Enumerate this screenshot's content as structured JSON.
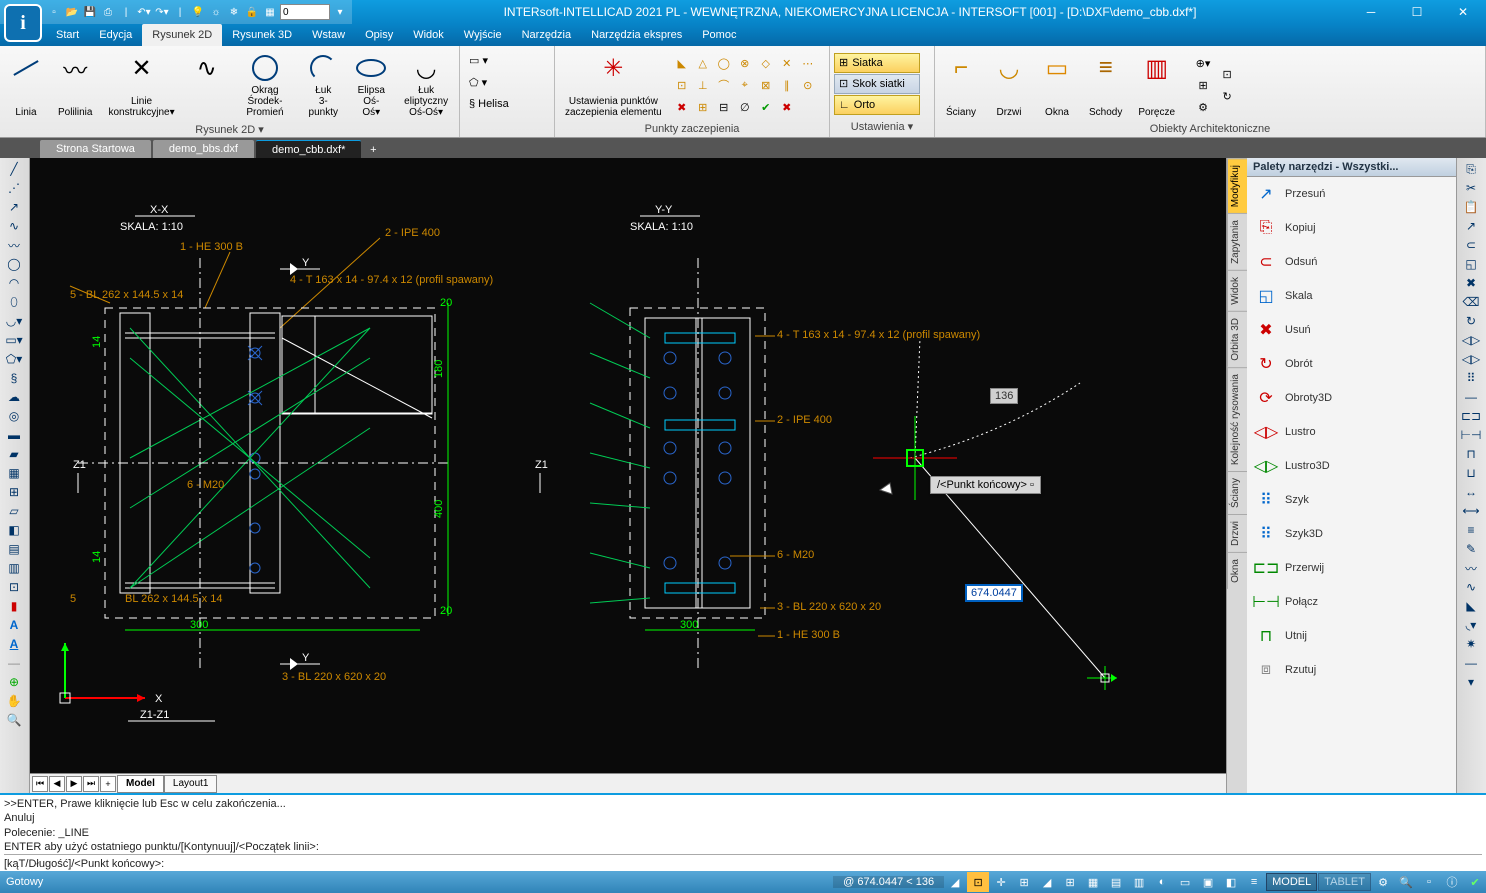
{
  "title": "INTERsoft-INTELLICAD 2021 PL - WEWNĘTRZNA, NIEKOMERCYJNA LICENCJA - INTERSOFT [001] - [D:\\DXF\\demo_cbb.dxf*]",
  "qat_value": "0",
  "menu": [
    "Start",
    "Edycja",
    "Rysunek 2D",
    "Rysunek 3D",
    "Wstaw",
    "Opisy",
    "Widok",
    "Wyjście",
    "Narzędzia",
    "Narzędzia ekspres",
    "Pomoc"
  ],
  "menu_active": 2,
  "ribbon": {
    "draw": {
      "label": "Rysunek 2D ▾",
      "buttons": {
        "line": "Linia",
        "polyline": "Polilinia",
        "constr_lines": "Linie\nkonstrukcyjne▾",
        "circle": "Okrąg\nŚrodek-Promień",
        "arc": "Łuk\n3-punkty",
        "ellipse": "Elipsa\nOś-Oś▾",
        "earc": "Łuk eliptyczny\nOś-Oś▾"
      },
      "helix": "Helisa"
    },
    "snap": {
      "label": "Punkty zaczepienia",
      "header": "Ustawienia punktów\nzaczepienia elementu"
    },
    "settings": {
      "label": "Ustawienia ▾",
      "grid": "Siatka",
      "grid_step": "Skok siatki",
      "ortho": "Orto"
    },
    "arch": {
      "label": "Obiekty Architektoniczne",
      "walls": "Ściany",
      "doors": "Drzwi",
      "windows": "Okna",
      "stairs": "Schody",
      "rails": "Poręcze"
    }
  },
  "doc_tabs": [
    "Strona Startowa",
    "demo_bbs.dxf",
    "demo_cbb.dxf*"
  ],
  "doc_tab_active": 2,
  "palette": {
    "title": "Palety narzędzi - Wszystki...",
    "tabs": [
      "Modyfikuj",
      "Zapytania",
      "Widok",
      "Orbita 3D",
      "Kolejność rysowania",
      "Ściany",
      "Drzwi",
      "Okna"
    ],
    "tab_active": 0,
    "items": [
      "Przesuń",
      "Kopiuj",
      "Odsuń",
      "Skala",
      "Usuń",
      "Obrót",
      "Obroty3D",
      "Lustro",
      "Lustro3D",
      "Szyk",
      "Szyk3D",
      "Przerwij",
      "Połącz",
      "Utnij",
      "Rzutuj"
    ]
  },
  "layout_tabs": [
    "Model",
    "Layout1"
  ],
  "layout_active": 0,
  "command_lines": [
    ">>ENTER, Prawe kliknięcie lub Esc w celu zakończenia...",
    "Anuluj",
    "Polecenie: _LINE",
    "ENTER aby użyć ostatniego punktu/[Kontynuuj]/<Początek linii>:"
  ],
  "command_prompt": "[kąT/Długość]/<Punkt końcowy>:",
  "status": {
    "left": "Gotowy",
    "coords": "@ 674.0447 < 136",
    "model": "MODEL",
    "tablet": "TABLET"
  },
  "canvas": {
    "tooltip": "/<Punkt końcowy>",
    "angle": "136",
    "coord": "674.0447",
    "labels": {
      "xx_title": "X-X",
      "xx_scale": "SKALA:  1:10",
      "yy_title": "Y-Y",
      "yy_scale": "SKALA:  1:10",
      "l1": "1 - HE 300 B",
      "l2": "2 - IPE 400",
      "l3": "3 - BL 220 x 620 x 20",
      "l4": "4 - T 163 x 14 - 97.4 x 12 (profil spawany)",
      "l5": "5 - BL 262 x 144.5 x 14",
      "l6": "6 - M20",
      "z1": "Z1",
      "dim300": "300",
      "dim400": "400",
      "dim180": "180",
      "dim20": "20",
      "dim14": "14",
      "y": "Y",
      "x": "X",
      "zz": "Z1-Z1",
      "bl": "BL 262 x 144.5 x 14"
    }
  }
}
